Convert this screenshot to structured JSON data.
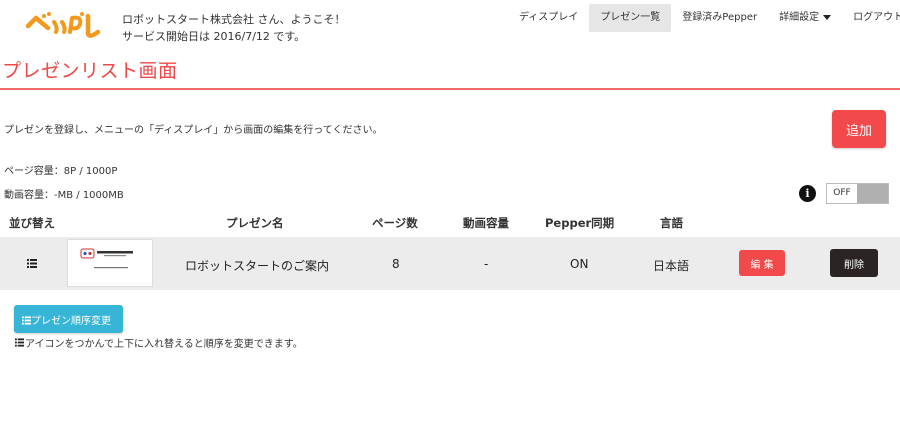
{
  "header": {
    "logo_text": "ぺっぷし",
    "welcome_line1": "ロボットスタート株式会社 さん、ようこそ！",
    "welcome_line2": "サービス開始日は 2016/7/12 です。"
  },
  "nav": {
    "display": "ディスプレイ",
    "presen_list": "プレゼン一覧",
    "registered_pepper": "登録済みPepper",
    "settings": "詳細設定",
    "logout": "ログアウト"
  },
  "page": {
    "title": "プレゼンリスト画面",
    "description": "プレゼンを登録し、メニューの「ディスプレイ」から画面の編集を行ってください。",
    "add_label": "追加",
    "page_capacity": "ページ容量：8P / 1000P",
    "video_capacity": "動画容量：-MB / 1000MB",
    "toggle_label": "OFF",
    "info_icon": "i"
  },
  "table": {
    "headers": {
      "sort": "並び替え",
      "name": "プレゼン名",
      "pages": "ページ数",
      "video": "動画容量",
      "sync": "Pepper同期",
      "language": "言語"
    },
    "rows": [
      {
        "name": "ロボットスタートのご案内",
        "pages": "8",
        "video": "-",
        "sync": "ON",
        "language": "日本語",
        "edit_label": "編 集",
        "delete_label": "削除"
      }
    ]
  },
  "footer": {
    "reorder_label": "プレゼン順序変更",
    "hint": "アイコンをつかんで上下に入れ替えると順序を変更できます。"
  },
  "colors": {
    "accent_red": "#f24a4a",
    "reorder_blue": "#37b5d6",
    "delete_dark": "#2a2524",
    "logo_orange": "#f39a1e"
  }
}
